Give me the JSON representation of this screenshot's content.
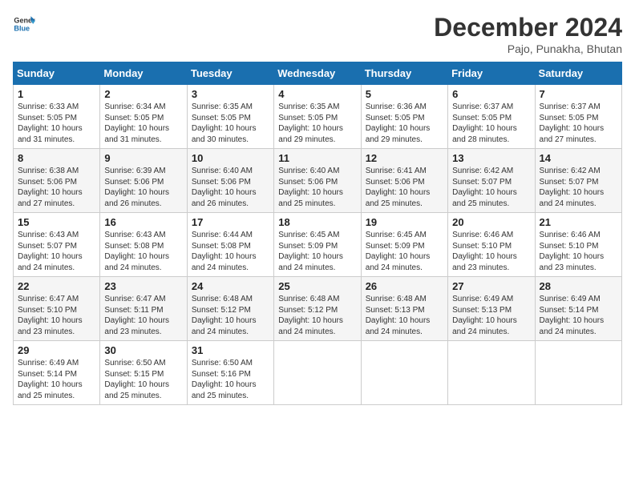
{
  "header": {
    "logo_general": "General",
    "logo_blue": "Blue",
    "month": "December 2024",
    "location": "Pajo, Punakha, Bhutan"
  },
  "weekdays": [
    "Sunday",
    "Monday",
    "Tuesday",
    "Wednesday",
    "Thursday",
    "Friday",
    "Saturday"
  ],
  "weeks": [
    [
      {
        "day": "1",
        "sunrise": "6:33 AM",
        "sunset": "5:05 PM",
        "daylight": "10 hours and 31 minutes."
      },
      {
        "day": "2",
        "sunrise": "6:34 AM",
        "sunset": "5:05 PM",
        "daylight": "10 hours and 31 minutes."
      },
      {
        "day": "3",
        "sunrise": "6:35 AM",
        "sunset": "5:05 PM",
        "daylight": "10 hours and 30 minutes."
      },
      {
        "day": "4",
        "sunrise": "6:35 AM",
        "sunset": "5:05 PM",
        "daylight": "10 hours and 29 minutes."
      },
      {
        "day": "5",
        "sunrise": "6:36 AM",
        "sunset": "5:05 PM",
        "daylight": "10 hours and 29 minutes."
      },
      {
        "day": "6",
        "sunrise": "6:37 AM",
        "sunset": "5:05 PM",
        "daylight": "10 hours and 28 minutes."
      },
      {
        "day": "7",
        "sunrise": "6:37 AM",
        "sunset": "5:05 PM",
        "daylight": "10 hours and 27 minutes."
      }
    ],
    [
      {
        "day": "8",
        "sunrise": "6:38 AM",
        "sunset": "5:06 PM",
        "daylight": "10 hours and 27 minutes."
      },
      {
        "day": "9",
        "sunrise": "6:39 AM",
        "sunset": "5:06 PM",
        "daylight": "10 hours and 26 minutes."
      },
      {
        "day": "10",
        "sunrise": "6:40 AM",
        "sunset": "5:06 PM",
        "daylight": "10 hours and 26 minutes."
      },
      {
        "day": "11",
        "sunrise": "6:40 AM",
        "sunset": "5:06 PM",
        "daylight": "10 hours and 25 minutes."
      },
      {
        "day": "12",
        "sunrise": "6:41 AM",
        "sunset": "5:06 PM",
        "daylight": "10 hours and 25 minutes."
      },
      {
        "day": "13",
        "sunrise": "6:42 AM",
        "sunset": "5:07 PM",
        "daylight": "10 hours and 25 minutes."
      },
      {
        "day": "14",
        "sunrise": "6:42 AM",
        "sunset": "5:07 PM",
        "daylight": "10 hours and 24 minutes."
      }
    ],
    [
      {
        "day": "15",
        "sunrise": "6:43 AM",
        "sunset": "5:07 PM",
        "daylight": "10 hours and 24 minutes."
      },
      {
        "day": "16",
        "sunrise": "6:43 AM",
        "sunset": "5:08 PM",
        "daylight": "10 hours and 24 minutes."
      },
      {
        "day": "17",
        "sunrise": "6:44 AM",
        "sunset": "5:08 PM",
        "daylight": "10 hours and 24 minutes."
      },
      {
        "day": "18",
        "sunrise": "6:45 AM",
        "sunset": "5:09 PM",
        "daylight": "10 hours and 24 minutes."
      },
      {
        "day": "19",
        "sunrise": "6:45 AM",
        "sunset": "5:09 PM",
        "daylight": "10 hours and 24 minutes."
      },
      {
        "day": "20",
        "sunrise": "6:46 AM",
        "sunset": "5:10 PM",
        "daylight": "10 hours and 23 minutes."
      },
      {
        "day": "21",
        "sunrise": "6:46 AM",
        "sunset": "5:10 PM",
        "daylight": "10 hours and 23 minutes."
      }
    ],
    [
      {
        "day": "22",
        "sunrise": "6:47 AM",
        "sunset": "5:10 PM",
        "daylight": "10 hours and 23 minutes."
      },
      {
        "day": "23",
        "sunrise": "6:47 AM",
        "sunset": "5:11 PM",
        "daylight": "10 hours and 23 minutes."
      },
      {
        "day": "24",
        "sunrise": "6:48 AM",
        "sunset": "5:12 PM",
        "daylight": "10 hours and 24 minutes."
      },
      {
        "day": "25",
        "sunrise": "6:48 AM",
        "sunset": "5:12 PM",
        "daylight": "10 hours and 24 minutes."
      },
      {
        "day": "26",
        "sunrise": "6:48 AM",
        "sunset": "5:13 PM",
        "daylight": "10 hours and 24 minutes."
      },
      {
        "day": "27",
        "sunrise": "6:49 AM",
        "sunset": "5:13 PM",
        "daylight": "10 hours and 24 minutes."
      },
      {
        "day": "28",
        "sunrise": "6:49 AM",
        "sunset": "5:14 PM",
        "daylight": "10 hours and 24 minutes."
      }
    ],
    [
      {
        "day": "29",
        "sunrise": "6:49 AM",
        "sunset": "5:14 PM",
        "daylight": "10 hours and 25 minutes."
      },
      {
        "day": "30",
        "sunrise": "6:50 AM",
        "sunset": "5:15 PM",
        "daylight": "10 hours and 25 minutes."
      },
      {
        "day": "31",
        "sunrise": "6:50 AM",
        "sunset": "5:16 PM",
        "daylight": "10 hours and 25 minutes."
      },
      null,
      null,
      null,
      null
    ]
  ]
}
